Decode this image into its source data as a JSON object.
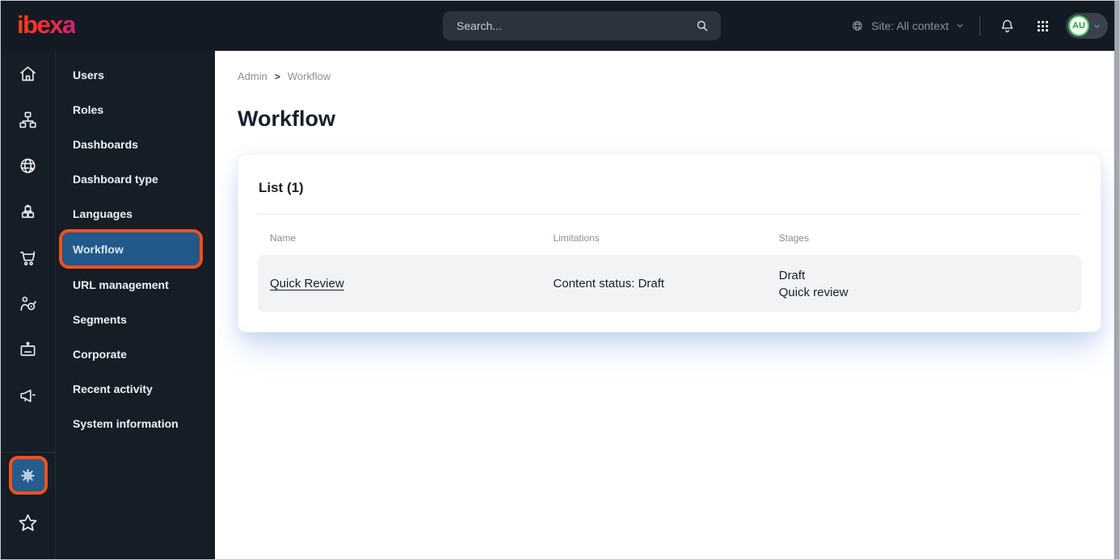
{
  "topbar": {
    "logo_text": "ibexa",
    "search": {
      "placeholder": "Search..."
    },
    "site_selector": {
      "label": "Site: All context"
    },
    "avatar": {
      "initials": "AU"
    }
  },
  "rail": {
    "items": [
      {
        "icon": "home-icon"
      },
      {
        "icon": "content-tree-icon"
      },
      {
        "icon": "site-globe-icon"
      },
      {
        "icon": "product-catalog-icon"
      },
      {
        "icon": "cart-icon"
      },
      {
        "icon": "personalization-target-icon"
      },
      {
        "icon": "corporate-badge-icon"
      },
      {
        "icon": "megaphone-icon"
      }
    ],
    "bottom": [
      {
        "icon": "settings-gear-icon",
        "active": true,
        "annotated": true
      },
      {
        "icon": "bookmarks-star-icon"
      }
    ]
  },
  "sidebar": {
    "items": [
      {
        "label": "Users",
        "active": false
      },
      {
        "label": "Roles",
        "active": false
      },
      {
        "label": "Dashboards",
        "active": false
      },
      {
        "label": "Dashboard type",
        "active": false
      },
      {
        "label": "Languages",
        "active": false
      },
      {
        "label": "Workflow",
        "active": true,
        "annotated": true
      },
      {
        "label": "URL management",
        "active": false
      },
      {
        "label": "Segments",
        "active": false
      },
      {
        "label": "Corporate",
        "active": false
      },
      {
        "label": "Recent activity",
        "active": false
      },
      {
        "label": "System information",
        "active": false
      }
    ]
  },
  "breadcrumb": {
    "items": [
      "Admin",
      "Workflow"
    ],
    "separator": ">"
  },
  "page": {
    "title": "Workflow"
  },
  "card": {
    "heading": "List (1)",
    "table": {
      "headers": [
        "Name",
        "Limitations",
        "Stages"
      ],
      "rows": [
        {
          "name": "Quick Review",
          "limitations": "Content status: Draft",
          "stages": [
            "Draft",
            "Quick review"
          ]
        }
      ]
    }
  },
  "colors": {
    "annotation_highlight": "#f3501d",
    "active_item_blue": "#21598a",
    "topbar_bg": "#131a24",
    "sidebar_bg": "#151d27",
    "avatar_green": "#4fc566",
    "logo_gradient_start": "#ff3d17",
    "logo_gradient_end": "#cf2374",
    "row_bg": "#f2f3f5"
  }
}
